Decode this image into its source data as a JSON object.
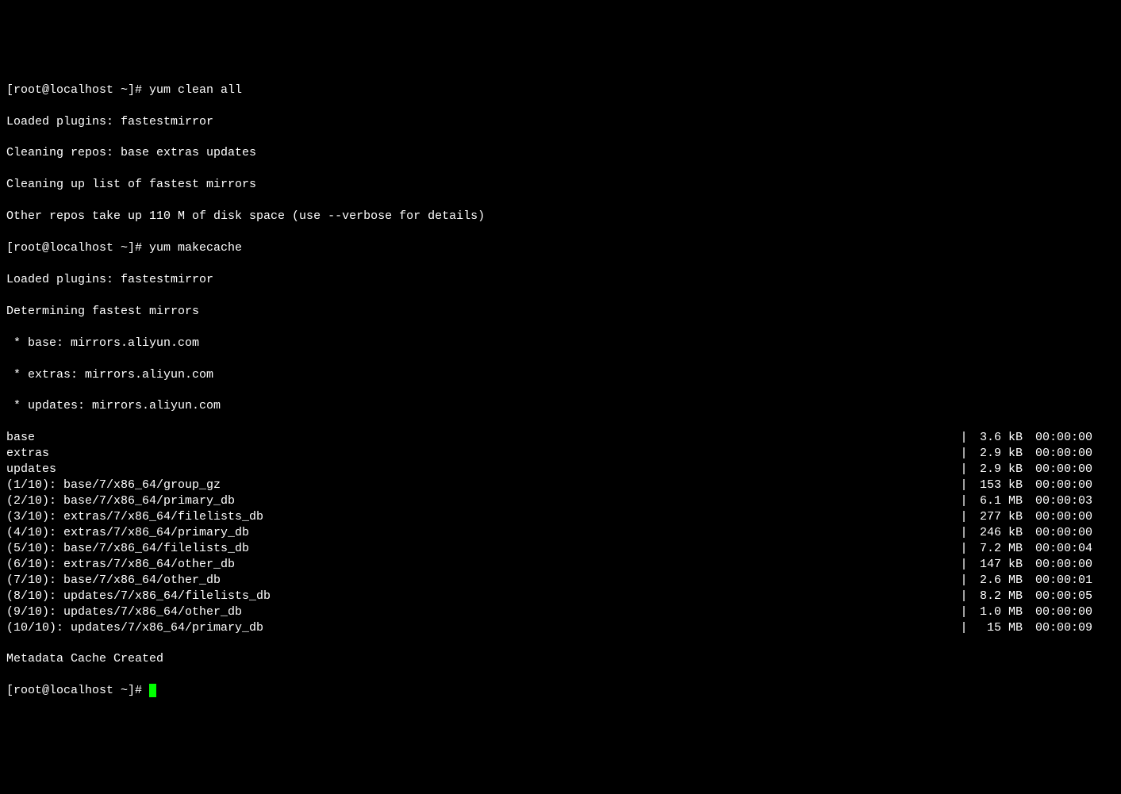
{
  "prompt1": "[root@localhost ~]# ",
  "cmd1": "yum clean all",
  "out1_1": "Loaded plugins: fastestmirror",
  "out1_2": "Cleaning repos: base extras updates",
  "out1_3": "Cleaning up list of fastest mirrors",
  "out1_4": "Other repos take up 110 M of disk space (use --verbose for details)",
  "prompt2": "[root@localhost ~]# ",
  "cmd2": "yum makecache",
  "out2_1": "Loaded plugins: fastestmirror",
  "out2_2": "Determining fastest mirrors",
  "out2_3": " * base: mirrors.aliyun.com",
  "out2_4": " * extras: mirrors.aliyun.com",
  "out2_5": " * updates: mirrors.aliyun.com",
  "downloads": [
    {
      "name": "base",
      "size": "3.6 kB",
      "time": "00:00:00"
    },
    {
      "name": "extras",
      "size": "2.9 kB",
      "time": "00:00:00"
    },
    {
      "name": "updates",
      "size": "2.9 kB",
      "time": "00:00:00"
    },
    {
      "name": "(1/10): base/7/x86_64/group_gz",
      "size": "153 kB",
      "time": "00:00:00"
    },
    {
      "name": "(2/10): base/7/x86_64/primary_db",
      "size": "6.1 MB",
      "time": "00:00:03"
    },
    {
      "name": "(3/10): extras/7/x86_64/filelists_db",
      "size": "277 kB",
      "time": "00:00:00"
    },
    {
      "name": "(4/10): extras/7/x86_64/primary_db",
      "size": "246 kB",
      "time": "00:00:00"
    },
    {
      "name": "(5/10): base/7/x86_64/filelists_db",
      "size": "7.2 MB",
      "time": "00:00:04"
    },
    {
      "name": "(6/10): extras/7/x86_64/other_db",
      "size": "147 kB",
      "time": "00:00:00"
    },
    {
      "name": "(7/10): base/7/x86_64/other_db",
      "size": "2.6 MB",
      "time": "00:00:01"
    },
    {
      "name": "(8/10): updates/7/x86_64/filelists_db",
      "size": "8.2 MB",
      "time": "00:00:05"
    },
    {
      "name": "(9/10): updates/7/x86_64/other_db",
      "size": "1.0 MB",
      "time": "00:00:00"
    },
    {
      "name": "(10/10): updates/7/x86_64/primary_db",
      "size": " 15 MB",
      "time": "00:00:09"
    }
  ],
  "out_final": "Metadata Cache Created",
  "prompt3": "[root@localhost ~]# "
}
